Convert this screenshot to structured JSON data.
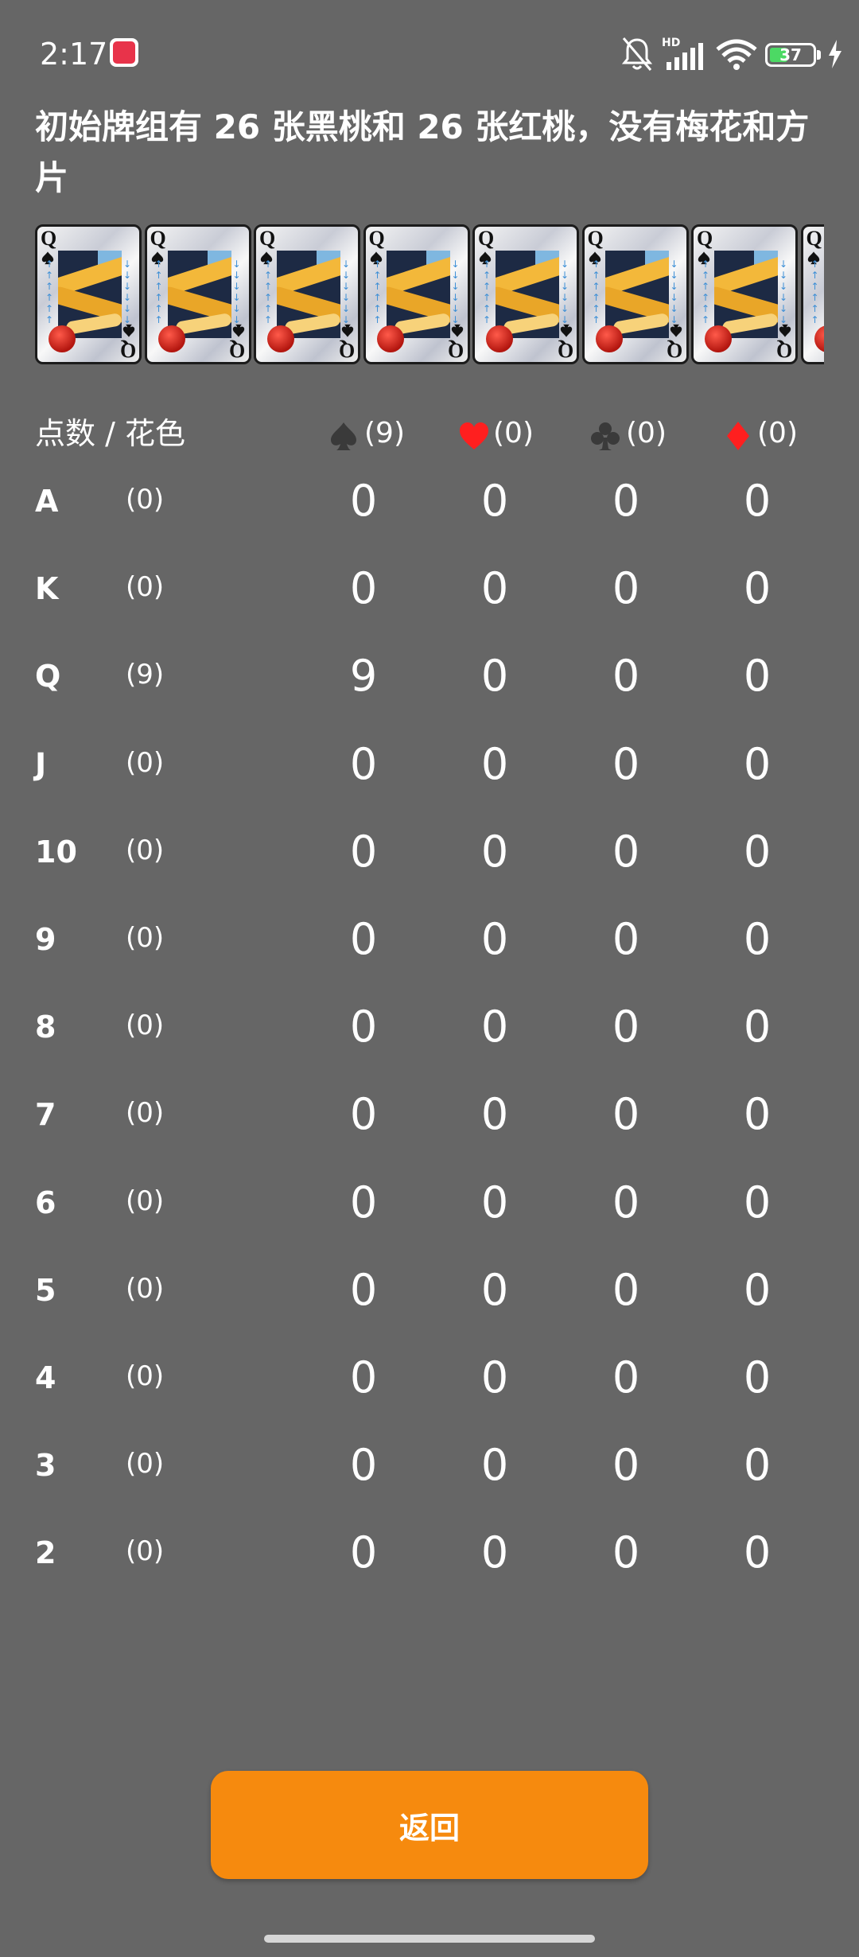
{
  "status_bar": {
    "time": "2:17",
    "battery": "37"
  },
  "title": "初始牌组有 26 张黑桃和 26 张红桃，没有梅花和方片",
  "cards": {
    "rank": "Q",
    "suit": "spade",
    "count_visible": 8
  },
  "table": {
    "header_label": "点数 / 花色",
    "suits": [
      {
        "name": "spade",
        "icon": "spade-icon",
        "color": "#3a3a3a",
        "count": "(9)"
      },
      {
        "name": "heart",
        "icon": "heart-icon",
        "color": "#ff1f1f",
        "count": "(0)"
      },
      {
        "name": "club",
        "icon": "club-icon",
        "color": "#3a3a3a",
        "count": "(0)"
      },
      {
        "name": "diamond",
        "icon": "diamond-icon",
        "color": "#ff1f1f",
        "count": "(0)"
      }
    ],
    "rows": [
      {
        "rank": "A",
        "total": "(0)",
        "spade": "0",
        "heart": "0",
        "club": "0",
        "diamond": "0"
      },
      {
        "rank": "K",
        "total": "(0)",
        "spade": "0",
        "heart": "0",
        "club": "0",
        "diamond": "0"
      },
      {
        "rank": "Q",
        "total": "(9)",
        "spade": "9",
        "heart": "0",
        "club": "0",
        "diamond": "0"
      },
      {
        "rank": "J",
        "total": "(0)",
        "spade": "0",
        "heart": "0",
        "club": "0",
        "diamond": "0"
      },
      {
        "rank": "10",
        "total": "(0)",
        "spade": "0",
        "heart": "0",
        "club": "0",
        "diamond": "0"
      },
      {
        "rank": "9",
        "total": "(0)",
        "spade": "0",
        "heart": "0",
        "club": "0",
        "diamond": "0"
      },
      {
        "rank": "8",
        "total": "(0)",
        "spade": "0",
        "heart": "0",
        "club": "0",
        "diamond": "0"
      },
      {
        "rank": "7",
        "total": "(0)",
        "spade": "0",
        "heart": "0",
        "club": "0",
        "diamond": "0"
      },
      {
        "rank": "6",
        "total": "(0)",
        "spade": "0",
        "heart": "0",
        "club": "0",
        "diamond": "0"
      },
      {
        "rank": "5",
        "total": "(0)",
        "spade": "0",
        "heart": "0",
        "club": "0",
        "diamond": "0"
      },
      {
        "rank": "4",
        "total": "(0)",
        "spade": "0",
        "heart": "0",
        "club": "0",
        "diamond": "0"
      },
      {
        "rank": "3",
        "total": "(0)",
        "spade": "0",
        "heart": "0",
        "club": "0",
        "diamond": "0"
      },
      {
        "rank": "2",
        "total": "(0)",
        "spade": "0",
        "heart": "0",
        "club": "0",
        "diamond": "0"
      }
    ]
  },
  "back_button": {
    "label": "返回",
    "color": "#f68a0e"
  }
}
